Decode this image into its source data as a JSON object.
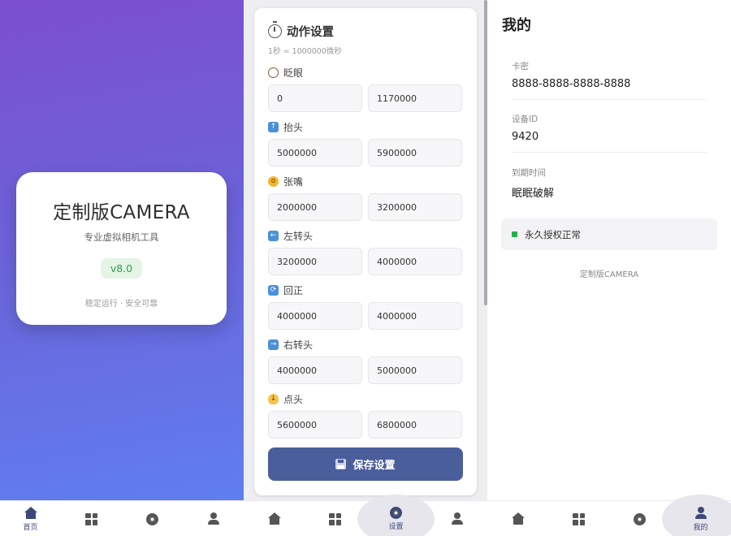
{
  "home": {
    "title": "定制版CAMERA",
    "subtitle": "专业虚拟相机工具",
    "version": "v8.0",
    "footer": "稳定运行 · 安全可靠"
  },
  "settings": {
    "title": "动作设置",
    "note": "1秒 = 1000000微秒",
    "actions": [
      {
        "label": "眨眼",
        "icon": "eye-icon",
        "start": "0",
        "end": "1170000"
      },
      {
        "label": "抬头",
        "icon": "arrow-up-icon",
        "start": "5000000",
        "end": "5900000"
      },
      {
        "label": "张嘴",
        "icon": "open-mouth-face-icon",
        "start": "2000000",
        "end": "3200000"
      },
      {
        "label": "左转头",
        "icon": "arrow-left-icon",
        "start": "3200000",
        "end": "4000000"
      },
      {
        "label": "回正",
        "icon": "refresh-icon",
        "start": "4000000",
        "end": "4000000"
      },
      {
        "label": "右转头",
        "icon": "arrow-right-icon",
        "start": "4000000",
        "end": "5000000"
      },
      {
        "label": "点头",
        "icon": "hand-point-down-icon",
        "start": "5600000",
        "end": "6800000"
      }
    ],
    "save_label": "保存设置"
  },
  "profile": {
    "title": "我的",
    "fields": [
      {
        "label": "卡密",
        "value": "8888-8888-8888-8888"
      },
      {
        "label": "设备ID",
        "value": "9420"
      },
      {
        "label": "到期时间",
        "value": "眠眠破解"
      }
    ],
    "status": "永久授权正常",
    "footer": "定制版CAMERA"
  },
  "nav": {
    "home_label": "首页",
    "settings_label": "设置",
    "profile_label": "我的"
  },
  "colors": {
    "accent": "#4b5e9c",
    "nav_active": "#3c4a7a",
    "status_ok": "#23b247",
    "version_badge": "#2f9d46"
  }
}
